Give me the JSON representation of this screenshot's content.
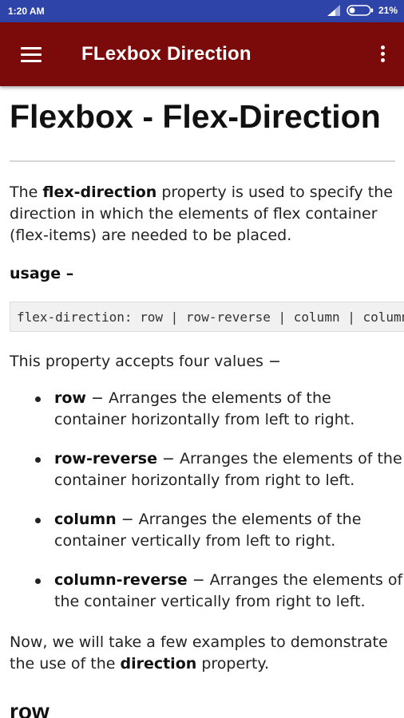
{
  "status_bar": {
    "time": "1:20 AM",
    "battery_percent": "21%",
    "icons": [
      "signal-icon",
      "battery-icon"
    ]
  },
  "app_bar": {
    "title": "FLexbox Direction",
    "menu_icon": "hamburger-menu-icon",
    "overflow_icon": "more-vertical-icon",
    "background_color": "#7b0b0b"
  },
  "article": {
    "title": "Flexbox - Flex-Direction",
    "intro": {
      "part1": "The ",
      "bold": "flex-direction",
      "part2": " property is used to specify the direction in which the elements of flex container (flex-items) are needed to be placed."
    },
    "usage_label": "usage –",
    "code": "flex-direction: row | row-reverse | column | column-reverse;",
    "values_intro": "This property accepts four values −",
    "values": [
      {
        "name": "row",
        "description": " − Arranges the elements of the container horizontally from left to right."
      },
      {
        "name": "row-reverse",
        "description": " − Arranges the elements of the container horizontally from right to left."
      },
      {
        "name": "column",
        "description": " − Arranges the elements of the container vertically from left to right."
      },
      {
        "name": "column-reverse",
        "description": " − Arranges the elements of the container vertically from right to left."
      }
    ],
    "outro": {
      "part1": "Now, we will take a few examples to demonstrate the use of the ",
      "bold": "direction",
      "part2": " property."
    },
    "next_heading": "row"
  }
}
